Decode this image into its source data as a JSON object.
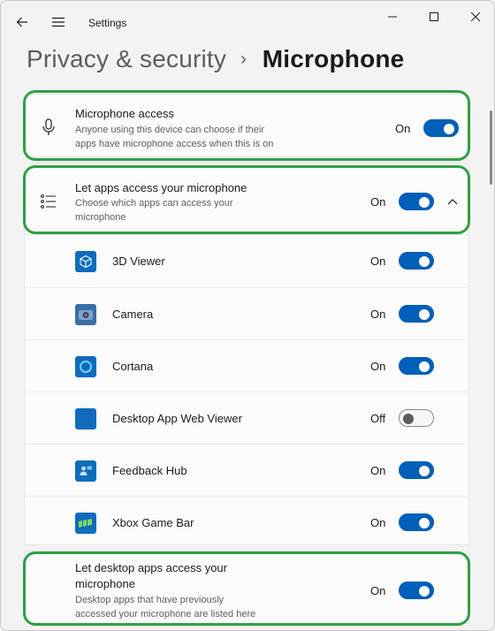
{
  "window": {
    "app_title": "Settings"
  },
  "breadcrumb": {
    "parent": "Privacy & security",
    "separator": "›",
    "current": "Microphone"
  },
  "microphone_access": {
    "title": "Microphone access",
    "description_line1": "Anyone using this device can choose if their",
    "description_line2": "apps have microphone access when this is on",
    "state": "On"
  },
  "let_apps_access": {
    "title": "Let apps access your microphone",
    "description_line1": "Choose which apps can access your",
    "description_line2": "microphone",
    "state": "On"
  },
  "apps": [
    {
      "name": "3D Viewer",
      "state": "On",
      "icon": "3d-viewer-icon"
    },
    {
      "name": "Camera",
      "state": "On",
      "icon": "camera-icon"
    },
    {
      "name": "Cortana",
      "state": "On",
      "icon": "cortana-icon"
    },
    {
      "name": "Desktop App Web Viewer",
      "state": "Off",
      "icon": "desktop-app-web-viewer-icon"
    },
    {
      "name": "Feedback Hub",
      "state": "On",
      "icon": "feedback-hub-icon"
    },
    {
      "name": "Xbox Game Bar",
      "state": "On",
      "icon": "xbox-game-bar-icon"
    }
  ],
  "desktop_apps_access": {
    "title_line1": "Let desktop apps access your",
    "title_line2": "microphone",
    "description_line1": "Desktop apps that have previously",
    "description_line2": "accessed your microphone are listed here",
    "state": "On"
  },
  "colors": {
    "accent": "#005fb8",
    "highlight": "#2ea043"
  }
}
